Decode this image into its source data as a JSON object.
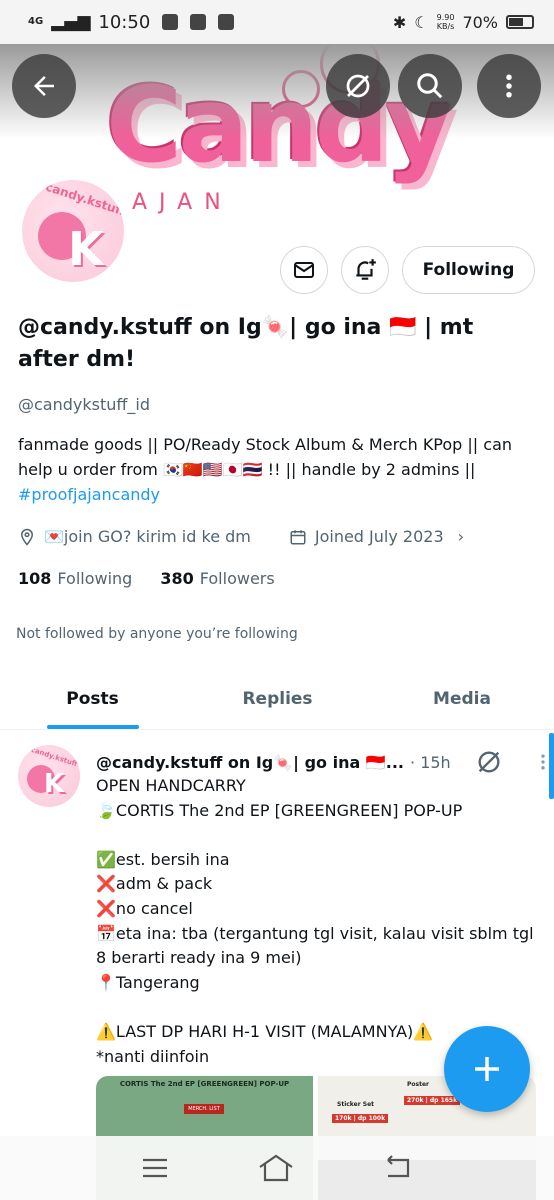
{
  "status_bar": {
    "network": "4G",
    "time": "10:50",
    "speed": "9.90\nKB/s",
    "battery": "70%"
  },
  "banner": {
    "word": "Candy",
    "sub": "AJAN"
  },
  "profile": {
    "avatar_text": "candy.kstuff",
    "avatar_letter": "K",
    "name": "@candy.kstuff on Ig🍬| go ina 🇮🇩 | mt after dm!",
    "handle": "@candykstuff_id",
    "bio": "fanmade goods || PO/Ready Stock Album & Merch KPop || can help u order from 🇰🇷🇨🇳🇺🇸🇯🇵🇹🇭 !! || handle by 2 admins || ",
    "bio_hashtag": "#proofjajancandy",
    "location": "💌join GO? kirim id ke dm",
    "joined": "Joined July 2023",
    "following_count": "108",
    "following_label": "Following",
    "followers_count": "380",
    "followers_label": "Followers",
    "not_followed": "Not followed by anyone you’re following",
    "follow_button": "Following"
  },
  "tabs": [
    "Posts",
    "Replies",
    "Media"
  ],
  "post": {
    "name": "@candy.kstuff on Ig🍬| go ina 🇮🇩...",
    "time": "· 15h",
    "body": "OPEN HANDCARRY\n🍃CORTIS The 2nd EP [GREENGREEN] POP-UP\n\n✅est. bersih ina\n❌adm & pack\n❌no cancel\n📅eta ina: tba (tergantung tgl visit, kalau visit sblm tgl 8 berarti ready ina 9 mei)\n📍Tangerang\n\n⚠️LAST DP HARI H-1 VISIT (MALAMNYA)⚠️\n*nanti diinfoin",
    "media1_title": "CORTIS The 2nd EP [GREENGREEN] POP-UP",
    "media1_badge": "MERCH. LIST",
    "media2_label1": "Sticker Set",
    "media2_label2": "Poster",
    "media2_price1": "170k | dp 100k",
    "media2_price2": "270k | dp 165k"
  },
  "colors": {
    "accent": "#1d9bf0",
    "brand_pink": "#f0609a"
  }
}
